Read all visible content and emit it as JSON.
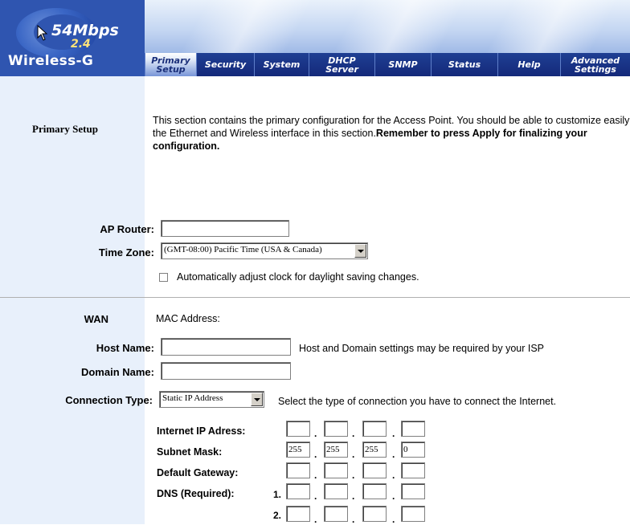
{
  "brand": {
    "speed": "54Mbps",
    "band": "2.4",
    "name": "Wireless-G"
  },
  "nav": {
    "tabs": [
      {
        "line1": "Primary",
        "line2": "Setup"
      },
      {
        "line1": "Security",
        "line2": ""
      },
      {
        "line1": "System",
        "line2": ""
      },
      {
        "line1": "DHCP",
        "line2": "Server"
      },
      {
        "line1": "SNMP",
        "line2": ""
      },
      {
        "line1": "Status",
        "line2": ""
      },
      {
        "line1": "Help",
        "line2": ""
      },
      {
        "line1": "Advanced",
        "line2": "Settings"
      }
    ]
  },
  "primary": {
    "title": "Primary Setup",
    "intro_normal": "This section contains the primary configuration for the Access Point. You should be able to customize easily the Ethernet and Wireless interface in this section.",
    "intro_bold": "Remember to press Apply for finalizing your configuration.",
    "ap_router_label": "AP Router:",
    "ap_router_value": "",
    "time_zone_label": "Time Zone:",
    "time_zone_value": "(GMT-08:00) Pacific Time (USA & Canada)",
    "dst_checkbox_label": "Automatically adjust clock for daylight saving changes."
  },
  "wan": {
    "title": "WAN",
    "mac_label": "MAC Address:",
    "host_name_label": "Host Name:",
    "host_hint": "Host and Domain settings may be required by your ISP",
    "domain_name_label": "Domain Name:",
    "connection_type_label": "Connection Type:",
    "connection_type_value": "Static IP Address",
    "connection_hint": "Select the type of connection you have to connect the Internet.",
    "ip_label": "Internet IP Adress:",
    "subnet_label": "Subnet Mask:",
    "subnet_values": [
      "255",
      "255",
      "255",
      "0"
    ],
    "gateway_label": "Default Gateway:",
    "dns_label": "DNS (Required):",
    "dns1_index": "1.",
    "dns2_index": "2."
  }
}
